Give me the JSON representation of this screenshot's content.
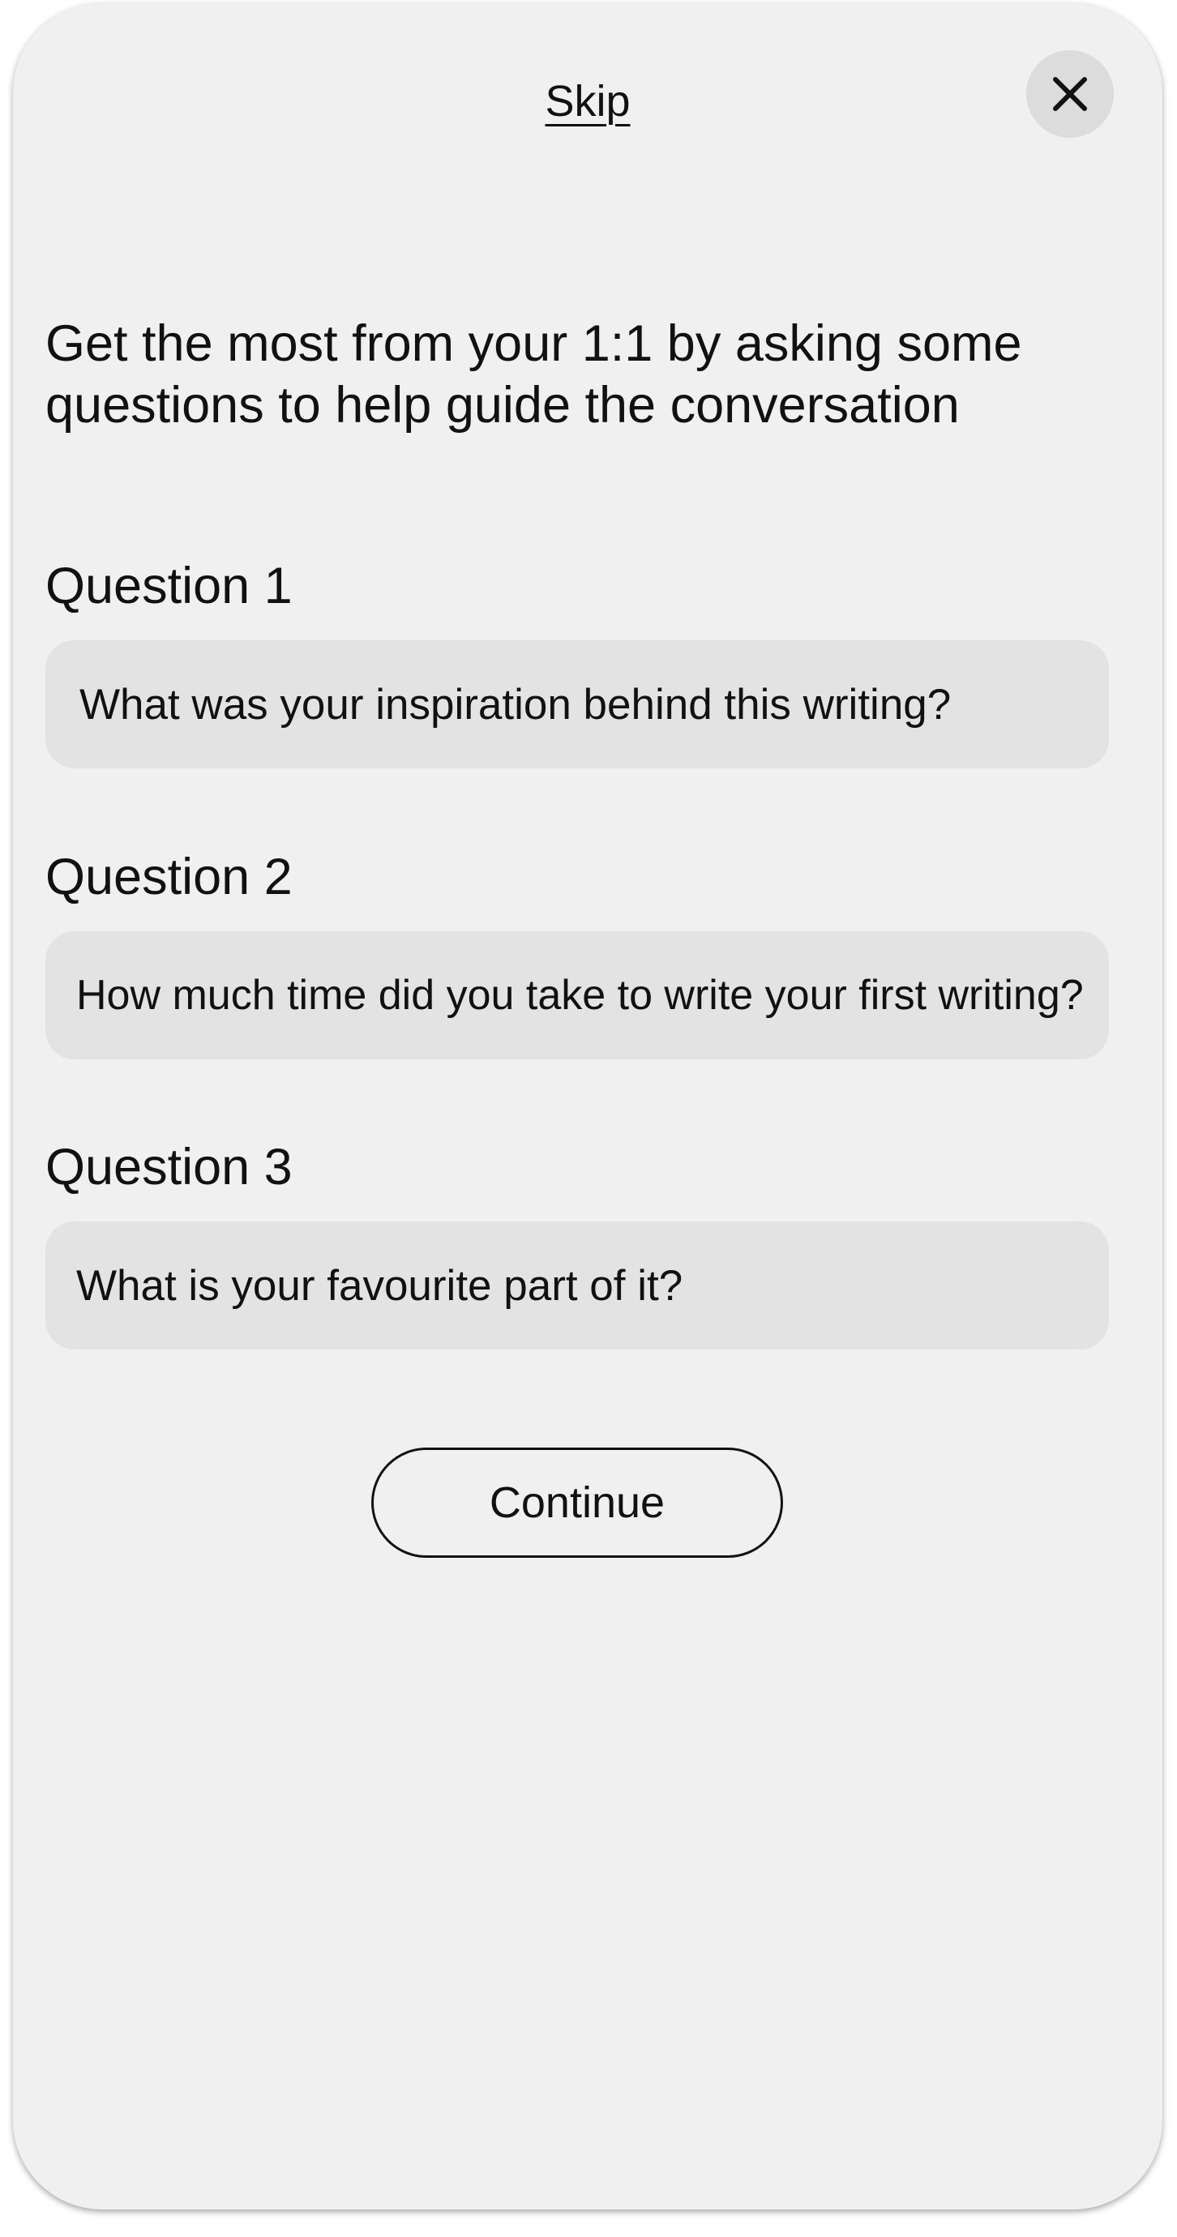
{
  "header": {
    "skip_label": "Skip",
    "close_icon": "close-icon"
  },
  "intro": {
    "text": "Get the most from your 1:1 by asking some questions to help guide the conversation"
  },
  "questions": [
    {
      "label": "Question 1",
      "value": "What was your inspiration behind this writing?"
    },
    {
      "label": "Question 2",
      "value": "How much time did you take to write your first writing?"
    },
    {
      "label": "Question 3",
      "value": "What is your favourite part of it?"
    }
  ],
  "actions": {
    "continue_label": "Continue"
  },
  "colors": {
    "background": "#f0f0f0",
    "field": "#e3e3e3",
    "close_button": "#dcdcdc",
    "text": "#111111"
  }
}
